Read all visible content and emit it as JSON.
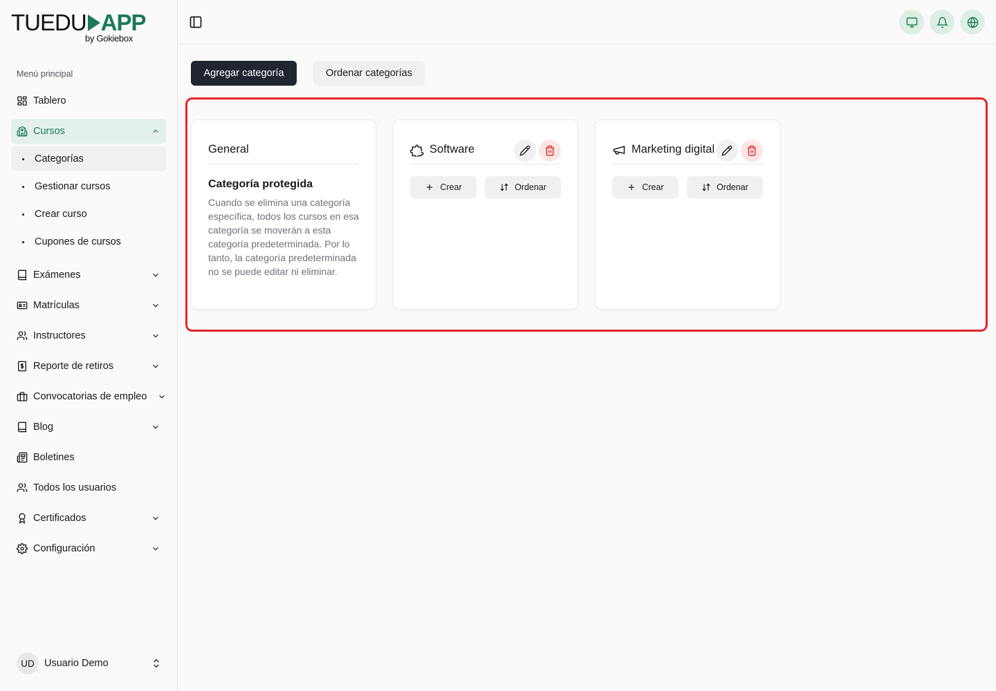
{
  "brand": {
    "logo_part1": "TUEDU",
    "logo_part2": "APP",
    "logo_sub": "by Gokiebox"
  },
  "sidebar": {
    "heading": "Menú principal",
    "items": [
      {
        "label": "Tablero",
        "icon": "dashboard-icon",
        "has_chevron": false
      },
      {
        "label": "Cursos",
        "icon": "school-icon",
        "has_chevron": true,
        "expanded": true,
        "active": true,
        "children": [
          {
            "label": "Categorías",
            "active": true
          },
          {
            "label": "Gestionar cursos"
          },
          {
            "label": "Crear curso"
          },
          {
            "label": "Cupones de cursos"
          }
        ]
      },
      {
        "label": "Exámenes",
        "icon": "book-icon",
        "has_chevron": true
      },
      {
        "label": "Matrículas",
        "icon": "id-card-icon",
        "has_chevron": true
      },
      {
        "label": "Instructores",
        "icon": "users-icon",
        "has_chevron": true
      },
      {
        "label": "Reporte de retiros",
        "icon": "dollar-receipt-icon",
        "has_chevron": true
      },
      {
        "label": "Convocatorias de empleo",
        "icon": "briefcase-icon",
        "has_chevron": true
      },
      {
        "label": "Blog",
        "icon": "book-icon",
        "has_chevron": true
      },
      {
        "label": "Boletines",
        "icon": "newspaper-icon",
        "has_chevron": false
      },
      {
        "label": "Todos los usuarios",
        "icon": "users-icon",
        "has_chevron": false
      },
      {
        "label": "Certificados",
        "icon": "award-icon",
        "has_chevron": true
      },
      {
        "label": "Configuración",
        "icon": "gear-icon",
        "has_chevron": true
      }
    ]
  },
  "user": {
    "initials": "UD",
    "name": "Usuario Demo"
  },
  "topbar": {
    "buttons": [
      "monitor-icon",
      "bell-icon",
      "globe-icon"
    ]
  },
  "toolbar": {
    "add_label": "Agregar categoría",
    "sort_label": "Ordenar categorías"
  },
  "categories": [
    {
      "title": "General",
      "protected": true,
      "protected_title": "Categoría protegida",
      "protected_text": "Cuando se elimina una categoría específica, todos los cursos en esa categoría se moverán a esta categoría predeterminada. Por lo tanto, la categoría predeterminada no se puede editar ni eliminar."
    },
    {
      "title": "Software",
      "icon": "puzzle-icon",
      "create_label": "Crear",
      "order_label": "Ordenar"
    },
    {
      "title": "Marketing digital",
      "icon": "megaphone-icon",
      "create_label": "Crear",
      "order_label": "Ordenar"
    }
  ],
  "colors": {
    "accent": "#1a7a55",
    "accent_bg": "#e3f1ea",
    "primary_button": "#1f2630",
    "danger": "#dc2626",
    "highlight_border": "#e5252c"
  }
}
